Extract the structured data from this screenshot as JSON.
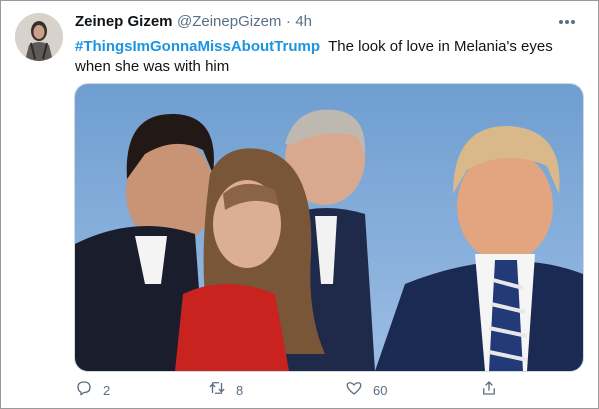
{
  "tweet": {
    "display_name": "Zeinep Gizem",
    "handle": "@ZeinepGizem",
    "separator": "·",
    "timestamp": "4h",
    "hashtag": "#ThingsImGonnaMissAboutTrump",
    "text": "The look of love in Melania's eyes when she was with him"
  },
  "actions": {
    "reply_count": "2",
    "retweet_count": "8",
    "like_count": "60"
  },
  "colors": {
    "link": "#1b95e0",
    "text": "#0f1419",
    "muted": "#5b7083"
  },
  "icons": [
    "more-icon",
    "reply-icon",
    "retweet-icon",
    "like-icon",
    "share-icon"
  ]
}
